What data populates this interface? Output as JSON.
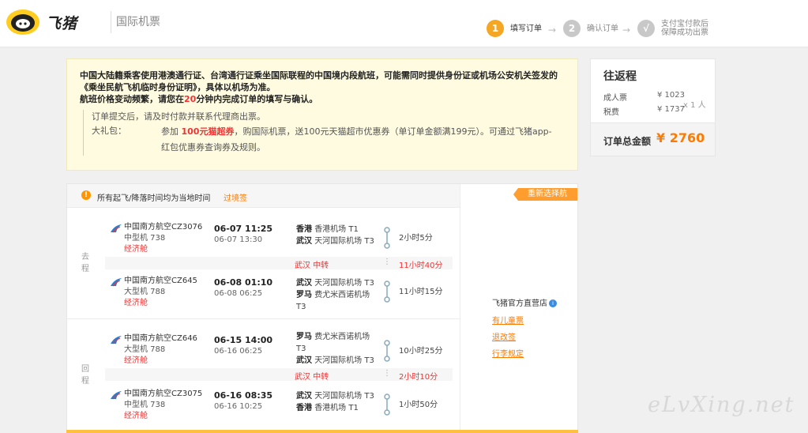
{
  "header": {
    "brand": "飞猪",
    "subtitle": "国际机票",
    "steps": [
      {
        "num": "1",
        "label": "填写订单",
        "state": "active"
      },
      {
        "num": "2",
        "label": "确认订单",
        "state": "pending"
      },
      {
        "num": "√",
        "label": "支付宝付款后\n保障成功出票",
        "state": "pending"
      }
    ],
    "colors": {
      "active": "#f5a623",
      "inactive": "#c8c8c8"
    }
  },
  "notice": {
    "line1": "中国大陆籍乘客使用港澳通行证、台湾通行证乘坐国际联程的中国境内段航班，可能需同时提供身份证或机场公安机关签发的《乘坐民航飞机临时身份证明》，具体以机场为准。",
    "line2_a": "航班价格变动频繁，请您在",
    "line2_minutes": "20",
    "line2_b": "分钟内完成订单的填写与确认。",
    "item1": "订单提交后，请及时付款并联系代理商出票。",
    "item2_label": "大礼包：",
    "item2_a": "参加 ",
    "item2_hl": "100元猫超券",
    "item2_b": "，购国际机票，送100元天猫超市优惠券（单订单金额满199元）。可通过飞猪app-红包优惠券查询券及规则。"
  },
  "summary": {
    "title": "往返程",
    "adult_label": "成人票",
    "adult_value": "¥ 1023",
    "tax_label": "税费",
    "tax_value": "¥ 1737",
    "count": "x 1 人",
    "total_label": "订单总金额",
    "total_value": "¥ 2760"
  },
  "panel": {
    "tz_icon": "!",
    "tz_text": "所有起飞/降落时间均为当地时间",
    "tz_link": "过境签",
    "rechoose": "重新选择航班",
    "shop": "飞猪官方直营店",
    "shop_badge": "i",
    "links": [
      "有儿童票",
      "退改签",
      "行李规定"
    ]
  },
  "outbound": {
    "label": "去程",
    "flights": [
      {
        "airline": "中国南方航空CZ3076",
        "plane": "中型机 738",
        "cabin": "经济舱",
        "dep_time": "06-07 11:25",
        "arr_time": "06-07 13:30",
        "dep_city": "香港",
        "dep_airport": "香港机场 T1",
        "arr_city": "武汉",
        "arr_airport": "天河国际机场 T3",
        "duration": "2小时5分"
      },
      {
        "airline": "中国南方航空CZ645",
        "plane": "大型机 788",
        "cabin": "经济舱",
        "dep_time": "06-08 01:10",
        "arr_time": "06-08 06:25",
        "dep_city": "武汉",
        "dep_airport": "天河国际机场 T3",
        "arr_city": "罗马",
        "arr_airport": "费尤米西诺机场 T3",
        "duration": "11小时15分"
      }
    ],
    "transfer": {
      "city": "武汉 中转",
      "duration": "11小时40分"
    }
  },
  "inbound": {
    "label": "回程",
    "flights": [
      {
        "airline": "中国南方航空CZ646",
        "plane": "大型机 788",
        "cabin": "经济舱",
        "dep_time": "06-15 14:00",
        "arr_time": "06-16 06:25",
        "dep_city": "罗马",
        "dep_airport": "费尤米西诺机场 T3",
        "arr_city": "武汉",
        "arr_airport": "天河国际机场 T3",
        "duration": "10小时25分"
      },
      {
        "airline": "中国南方航空CZ3075",
        "plane": "中型机 738",
        "cabin": "经济舱",
        "dep_time": "06-16 08:35",
        "arr_time": "06-16 10:25",
        "dep_city": "武汉",
        "dep_airport": "天河国际机场 T3",
        "arr_city": "香港",
        "arr_airport": "香港机场 T1",
        "duration": "1小时50分"
      }
    ],
    "transfer": {
      "city": "武汉 中转",
      "duration": "2小时10分"
    }
  },
  "watermark": "eLvXing.net"
}
